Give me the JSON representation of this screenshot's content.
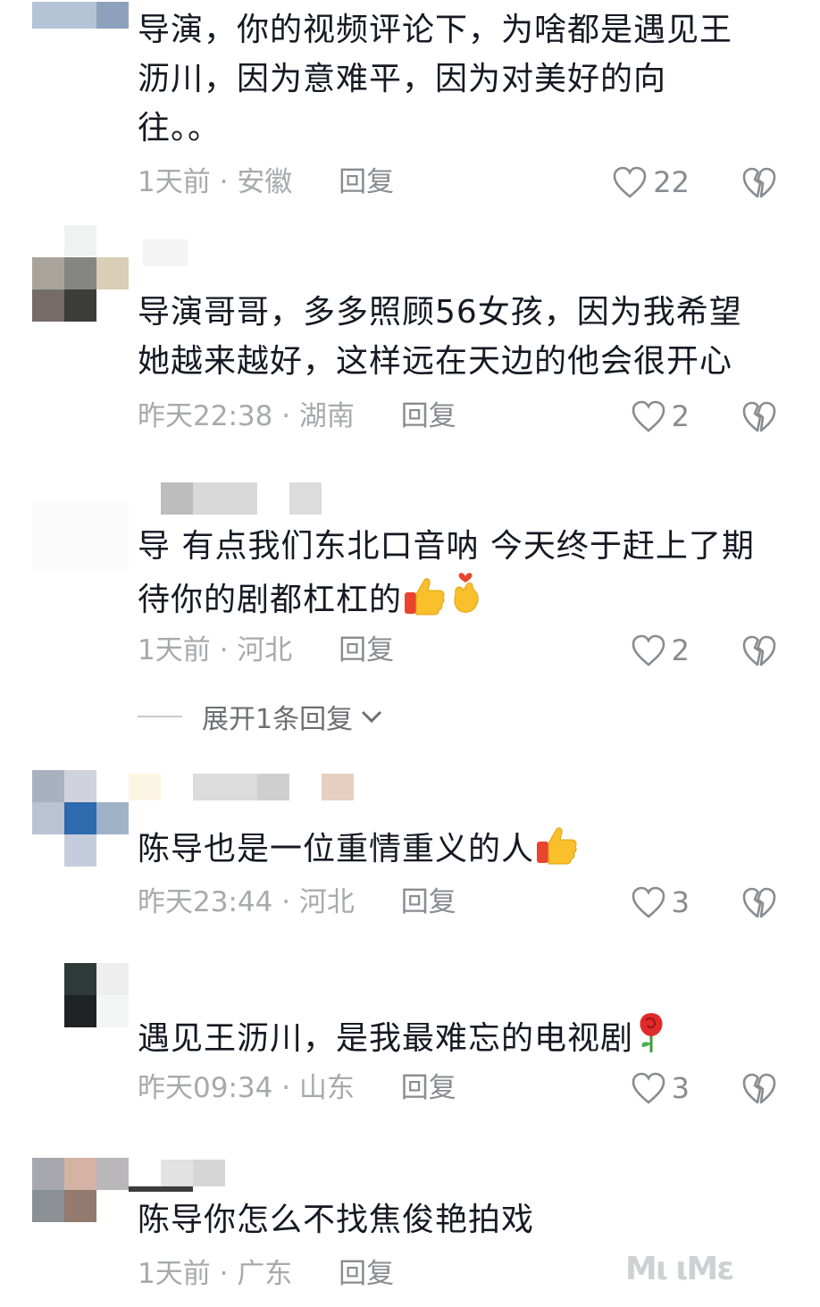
{
  "icons": {
    "like": "heart-outline-icon",
    "dislike": "broken-heart-icon",
    "expand": "chevron-down-icon"
  },
  "colors": {
    "text": "#161823",
    "meta": "#a8a9ad",
    "icon": "#8a8b91"
  },
  "comments": [
    {
      "lines": [
        "导演，你的视频评论下，为啥都是遇见王",
        "沥川，因为意难平，因为对美好的向",
        "往。。"
      ],
      "time": "1天前",
      "location": "安徽",
      "reply_label": "回复",
      "likes": "22"
    },
    {
      "lines": [
        "导演哥哥，多多照顾56女孩，因为我希望",
        "她越来越好，这样远在天边的他会很开心"
      ],
      "time": "昨天22:38",
      "location": "湖南",
      "reply_label": "回复",
      "likes": "2"
    },
    {
      "lines": [
        "导 有点我们东北口音呐 今天终于赶上了期",
        "待你的剧都杠杠的"
      ],
      "time": "1天前",
      "location": "河北",
      "reply_label": "回复",
      "likes": "2",
      "expand_label": "展开1条回复"
    },
    {
      "lines": [
        "陈导也是一位重情重义的人"
      ],
      "time": "昨天23:44",
      "location": "河北",
      "reply_label": "回复",
      "likes": "3"
    },
    {
      "lines": [
        "遇见王沥川，是我最难忘的电视剧"
      ],
      "time": "昨天09:34",
      "location": "山东",
      "reply_label": "回复",
      "likes": "3"
    },
    {
      "lines": [
        "陈导你怎么不找焦俊艳拍戏"
      ],
      "time": "1天前",
      "location": "广东",
      "reply_label": "回复"
    }
  ],
  "watermark": "Mι ιΜε"
}
